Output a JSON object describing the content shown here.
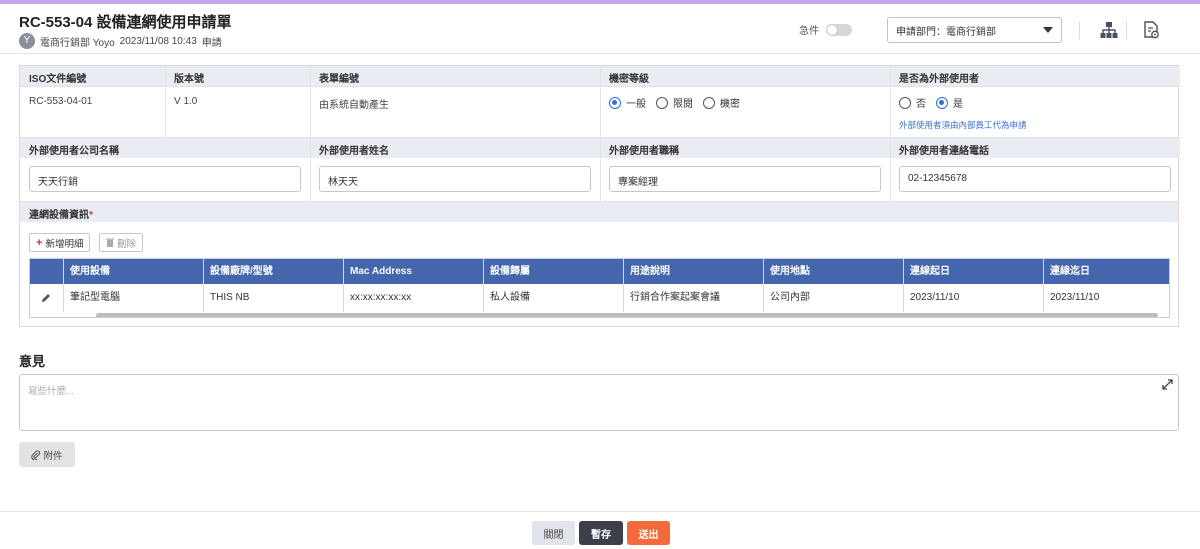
{
  "header": {
    "title": "RC-553-04 設備連網使用申請單",
    "avatar_letter": "Y",
    "applicant": "電商行銷部 Yoyo",
    "datetime": "2023/11/08 10:43",
    "action": "申請",
    "urgent_label": "急件",
    "urgent_on": false,
    "dept_select_value": "申請部門：電商行銷部",
    "icons": [
      "org-chart-icon",
      "document-settings-icon"
    ]
  },
  "form": {
    "iso_label": "ISO文件編號",
    "iso_value": "RC-553-04-01",
    "version_label": "版本號",
    "version_value": "V 1.0",
    "form_no_label": "表單編號",
    "form_no_value": "由系統自動產生",
    "security_label": "機密等級",
    "security_options": [
      "一般",
      "限閱",
      "機密"
    ],
    "security_selected": "一般",
    "external_label": "是否為外部使用者",
    "external_options": [
      "否",
      "是"
    ],
    "external_selected": "是",
    "external_hint": "外部使用者須由內部員工代為申請",
    "company_label": "外部使用者公司名稱",
    "company_value": "天天行銷",
    "name_label": "外部使用者姓名",
    "name_value": "林天天",
    "title_label": "外部使用者職稱",
    "title_value": "專案經理",
    "phone_label": "外部使用者連絡電話",
    "phone_value": "02-12345678",
    "device_section_label": "連網設備資訊",
    "required_mark": "*",
    "add_button": "新增明細",
    "delete_button": "刪除"
  },
  "device_table": {
    "columns": [
      "使用設備",
      "設備廠牌/型號",
      "Mac Address",
      "設備歸屬",
      "用途說明",
      "使用地點",
      "連線起日",
      "連線迄日"
    ],
    "rows": [
      [
        "筆記型電腦",
        "THIS NB",
        "xx:xx:xx:xx:xx",
        "私人設備",
        "行銷合作案起案會議",
        "公司內部",
        "2023/11/10",
        "2023/11/10"
      ]
    ]
  },
  "opinion": {
    "title": "意見",
    "placeholder": "寫些什麼..."
  },
  "attach_button": "附件",
  "footer": {
    "close": "關閉",
    "save": "暫存",
    "send": "送出"
  },
  "colors": {
    "accent_bar": "#c9a6e8",
    "table_header": "#4366ad",
    "radio_selected": "#2f6fdb",
    "send_button": "#f46a3c",
    "save_button": "#3a3f4a"
  }
}
